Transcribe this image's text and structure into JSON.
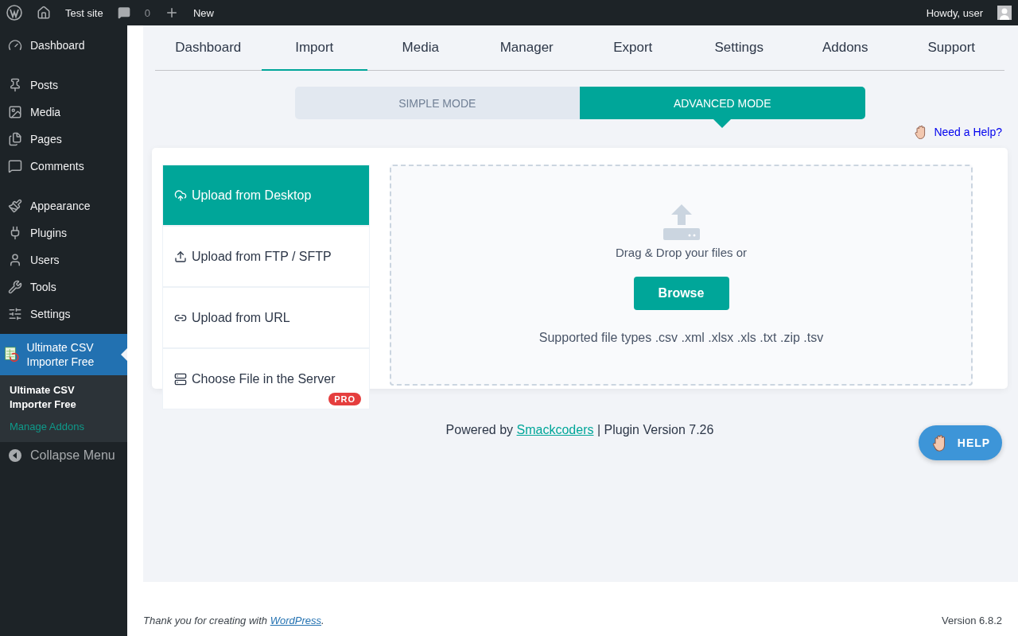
{
  "admin_bar": {
    "site": "Test site",
    "comments": "0",
    "new": "New",
    "greeting": "Howdy, user"
  },
  "sidebar": {
    "groups": [
      [
        {
          "label": "Dashboard",
          "selected": false
        }
      ],
      [
        {
          "label": "Posts",
          "selected": false
        },
        {
          "label": "Media",
          "selected": false
        },
        {
          "label": "Pages",
          "selected": false
        },
        {
          "label": "Comments",
          "selected": false
        }
      ],
      [
        {
          "label": "Appearance",
          "selected": false
        },
        {
          "label": "Plugins",
          "selected": false
        },
        {
          "label": "Users",
          "selected": false
        },
        {
          "label": "Tools",
          "selected": false
        },
        {
          "label": "Settings",
          "selected": false
        }
      ]
    ],
    "current": {
      "label": "Ultimate CSV Importer Free",
      "selected": true,
      "submenu": [
        {
          "label": "Ultimate CSV Importer Free",
          "selected": true
        },
        {
          "label": "Manage Addons",
          "selected": false
        }
      ]
    },
    "collapse": "Collapse Menu"
  },
  "tabs": [
    {
      "label": "Dashboard",
      "selected": false
    },
    {
      "label": "Import",
      "selected": true
    },
    {
      "label": "Media",
      "selected": false
    },
    {
      "label": "Manager",
      "selected": false
    },
    {
      "label": "Export",
      "selected": false
    },
    {
      "label": "Settings",
      "selected": false
    },
    {
      "label": "Addons",
      "selected": false
    },
    {
      "label": "Support",
      "selected": false
    }
  ],
  "modes": [
    {
      "label": "SIMPLE MODE",
      "selected": false
    },
    {
      "label": "ADVANCED MODE",
      "selected": true
    }
  ],
  "help_link": "Need a Help?",
  "sources": [
    {
      "label": "Upload from Desktop",
      "selected": true
    },
    {
      "label": "Upload from FTP / SFTP",
      "selected": false
    },
    {
      "label": "Upload from URL",
      "selected": false
    },
    {
      "label": "Choose File in the Server",
      "selected": false,
      "badge": "PRO"
    }
  ],
  "dropzone": {
    "prompt": "Drag & Drop your files or",
    "button": "Browse",
    "supported": "Supported file types .csv .xml .xlsx .xls .txt .zip .tsv"
  },
  "powered": {
    "prefix": "Powered by",
    "link": "Smackcoders",
    "suffix": "| Plugin Version 7.26"
  },
  "help_button": "HELP",
  "footer": {
    "thanks": "Thank you for creating with",
    "link": "WordPress",
    "end": ".",
    "version": "Version 6.8.2"
  }
}
